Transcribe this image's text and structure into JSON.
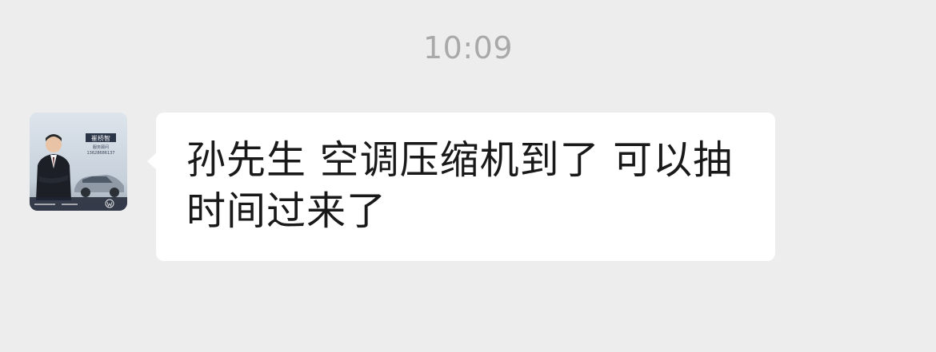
{
  "chat": {
    "timestamp": "10:09",
    "message": {
      "text": "孙先生 空调压缩机到了 可以抽时间过来了",
      "sender_avatar": {
        "name_card": "崔桥智",
        "title_card": "服务顾问",
        "phone_card": "13628686137",
        "icon": "vw-logo-icon"
      }
    }
  },
  "colors": {
    "background": "#ededed",
    "bubble": "#ffffff",
    "timestamp": "#a9a9a9",
    "text": "#191919"
  }
}
